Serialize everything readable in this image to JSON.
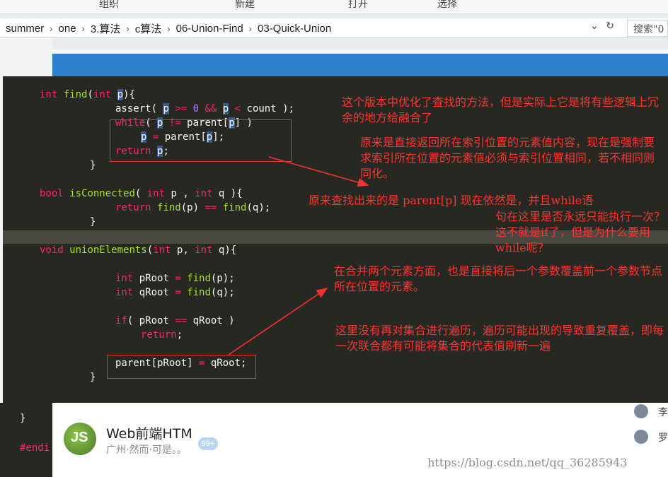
{
  "ribbon": {
    "items": [
      "组织",
      "新建",
      "打开",
      "选择"
    ]
  },
  "addressbar": {
    "breadcrumbs": [
      "summer",
      "one",
      "3.算法",
      "c算法",
      "06-Union-Find",
      "03-Quick-Union"
    ],
    "search_placeholder": "搜索\"0"
  },
  "code": {
    "find_sig": "int find(int p){",
    "assert": "assert( p >= 0 && p < count );",
    "while": "while( p != parent[p] )",
    "assign": "p = parent[p];",
    "ret": "return p;",
    "close1": "}",
    "isconn_sig": "bool isConnected( int p , int q ){",
    "isconn_ret": "return find(p) == find(q);",
    "close2": "}",
    "union_sig": "void unionElements(int p, int q){",
    "proot": "int pRoot = find(p);",
    "qroot": "int qRoot = find(q);",
    "if": "if( pRoot == qRoot )",
    "ret2": "return;",
    "set": "parent[pRoot] = qRoot;",
    "close3": "}"
  },
  "notes": {
    "n1": "这个版本中优化了查找的方法，但是实际上它是将有些逻辑上冗余的地方给融合了",
    "n2": "原来是直接返回所在索引位置的元素值内容，现在是强制要求索引所在位置的元素值必须与索引位置相同，若不相同则同化。",
    "n3": "原来查找出来的是 parent[p] 现在依然是，并且while语",
    "n4": "句在这里是否永远只能执行一次？这不就是if了，但是为什么要用while呢？",
    "n5": "在合并两个元素方面，也是直接将后一个参数覆盖前一个参数节点所在位置的元素。",
    "n6": "这里没有再对集合进行遍历，遍历可能出现的导致重复覆盖，即每一次联合都有可能将集合的代表值刷新一遍"
  },
  "bottom": {
    "editor_brace": "}",
    "editor_endif": "#endi",
    "card_title": "Web前端HTML",
    "card_sub": "广州·然而·可是。。",
    "card_badge": "99+",
    "users": [
      "李",
      "罗"
    ],
    "watermark": "https://blog.csdn.net/qq_36285943"
  },
  "colors": {
    "note_red": "#ff3333",
    "code_bg": "#272822",
    "keyword": "#f92672",
    "function": "#a6e22e"
  }
}
